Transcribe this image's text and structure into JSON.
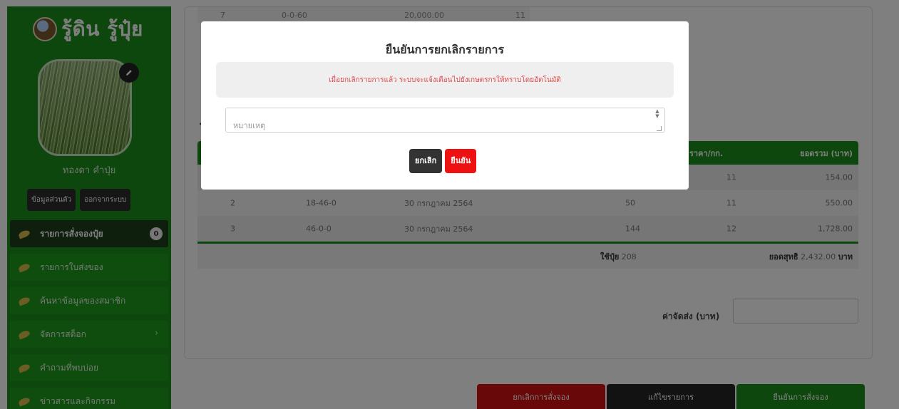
{
  "sidebar": {
    "logo_text": "รู้ดิน รู้ปุ๋ย",
    "user_name": "ทองดา คำปุ่ย",
    "profile_button": "ข้อมูลส่วนตัว",
    "logout_button": "ออกจากระบบ",
    "items": [
      {
        "label": "รายการสั่งจองปุ๋ย",
        "badge": "0"
      },
      {
        "label": "รายการใบส่งของ"
      },
      {
        "label": "ค้นหาข้อมูลของสมาชิก"
      },
      {
        "label": "จัดการสต็อก",
        "arrow": "›"
      },
      {
        "label": "คำถามที่พบบ่อย"
      },
      {
        "label": "ข่าวสารและกิจกรรม"
      }
    ]
  },
  "main": {
    "top_row": {
      "no": "7",
      "formula": "0-0-60",
      "amount": "20,000.00",
      "price": "11"
    },
    "section_fragment": "ร",
    "table": {
      "col_price": "ราคา/กก.",
      "col_total": "ยอดรวม (บาท)",
      "rows": [
        {
          "price": "11",
          "total": "154.00"
        },
        {
          "no": "2",
          "formula": "18-46-0",
          "date": "30 กรกฎาคม 2564",
          "qty": "50",
          "price": "11",
          "total": "550.00"
        },
        {
          "no": "3",
          "formula": "46-0-0",
          "date": "30 กรกฎาคม 2564",
          "qty": "144",
          "price": "12",
          "total": "1,728.00"
        }
      ],
      "used_label": "ใช้ปุ๋ย",
      "used_value": "208",
      "net_label": "ยอดสุทธิ",
      "net_value": "2,432.00",
      "net_unit": "บาท"
    },
    "shipping_label": "ค่าจัดส่ง (บาท)",
    "shipping_value": ""
  },
  "actions": {
    "cancel_order": "ยกเลิกการสั่งจอง",
    "edit_order": "แก้ไขรายการ",
    "confirm_order": "ยืนยันการสั่งจอง"
  },
  "modal": {
    "title": "ยืนยันการยกเลิกรายการ",
    "alert": "เมื่อยกเลิกรายการแล้ว ระบบจะแจ้งเตือนไปยังเกษตรกรให้ทราบโดยอัตโนมัติ",
    "note_placeholder": "หมายเหตุ",
    "cancel_button": "ยกเลิก",
    "confirm_button": "ยืนยัน"
  }
}
